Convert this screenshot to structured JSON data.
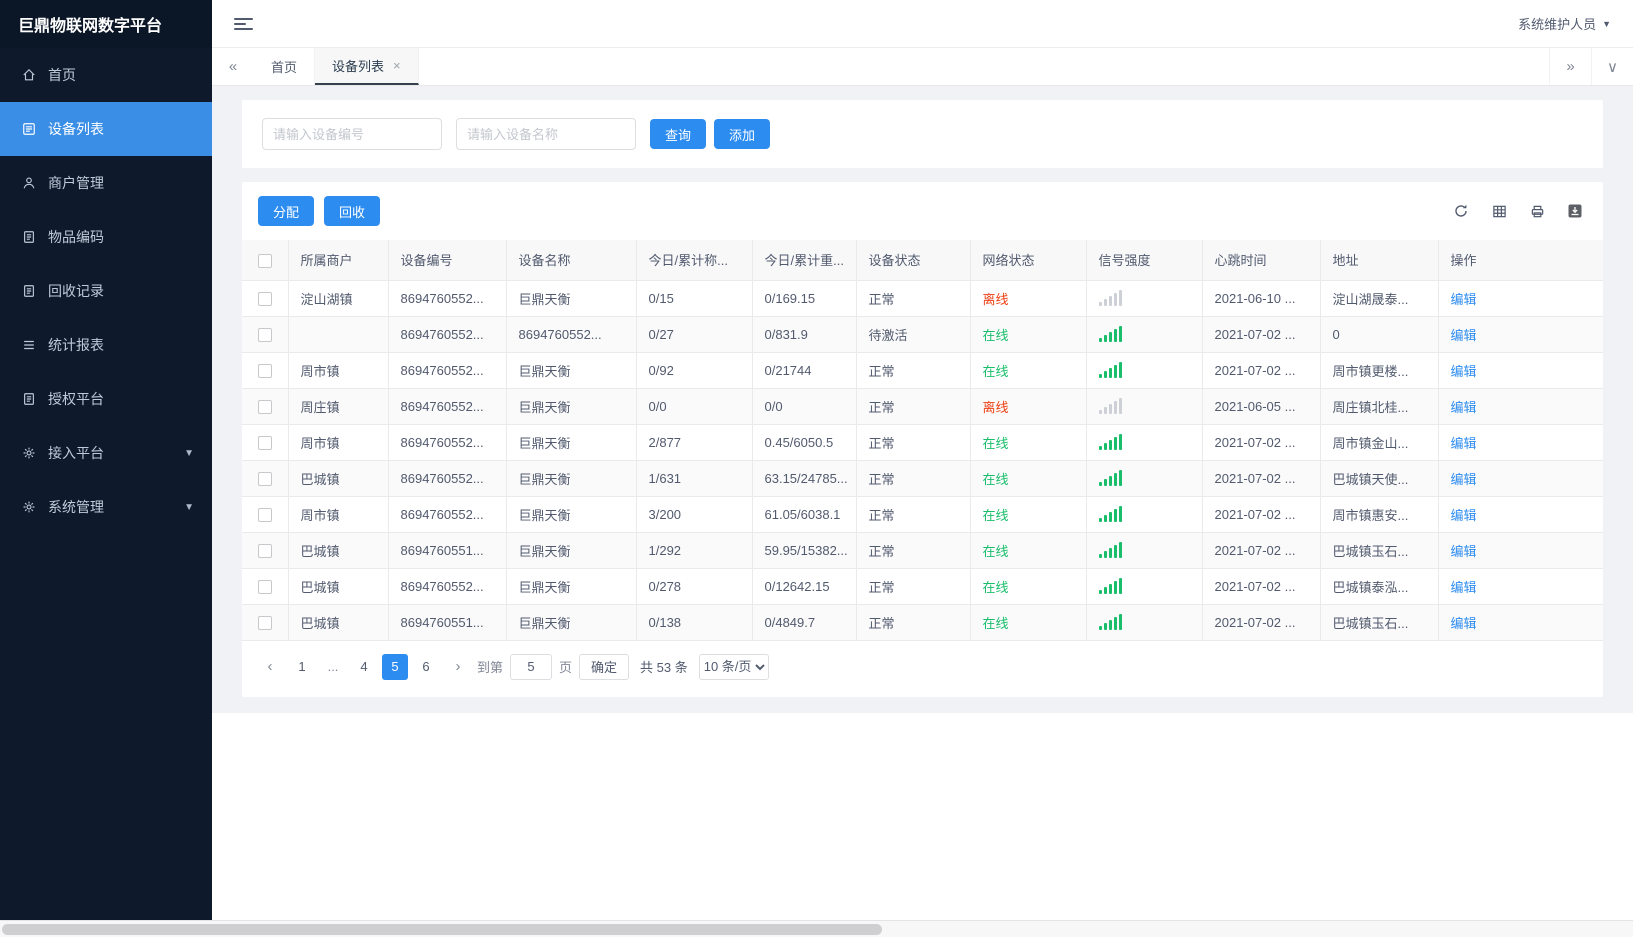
{
  "app": {
    "title": "巨鼎物联网数字平台",
    "user": "系统维护人员"
  },
  "colors": {
    "accent": "#2d8cf0",
    "sidebar_active": "#3a8ee6",
    "online": "#19be6b",
    "offline": "#ed4014"
  },
  "sidebar": {
    "items": [
      {
        "label": "首页",
        "icon": "home",
        "active": false,
        "expandable": false
      },
      {
        "label": "设备列表",
        "icon": "list",
        "active": true,
        "expandable": false
      },
      {
        "label": "商户管理",
        "icon": "user",
        "active": false,
        "expandable": false
      },
      {
        "label": "物品编码",
        "icon": "doc",
        "active": false,
        "expandable": false
      },
      {
        "label": "回收记录",
        "icon": "doc",
        "active": false,
        "expandable": false
      },
      {
        "label": "统计报表",
        "icon": "lines",
        "active": false,
        "expandable": false
      },
      {
        "label": "授权平台",
        "icon": "doc",
        "active": false,
        "expandable": false
      },
      {
        "label": "接入平台",
        "icon": "gear",
        "active": false,
        "expandable": true
      },
      {
        "label": "系统管理",
        "icon": "gear",
        "active": false,
        "expandable": true
      }
    ]
  },
  "tabs": [
    {
      "label": "首页",
      "active": false,
      "closable": false
    },
    {
      "label": "设备列表",
      "active": true,
      "closable": true
    }
  ],
  "search": {
    "device_no_placeholder": "请输入设备编号",
    "device_name_placeholder": "请输入设备名称",
    "query_label": "查询",
    "add_label": "添加"
  },
  "toolbar": {
    "allocate_label": "分配",
    "recycle_label": "回收",
    "icons": [
      "refresh",
      "columns",
      "print",
      "export"
    ]
  },
  "table": {
    "columns": [
      "所属商户",
      "设备编号",
      "设备名称",
      "今日/累计称...",
      "今日/累计重...",
      "设备状态",
      "网络状态",
      "信号强度",
      "心跳时间",
      "地址",
      "操作"
    ],
    "edit_label": "编辑",
    "rows": [
      {
        "merchant": "淀山湖镇",
        "device_no": "8694760552...",
        "device_name": "巨鼎天衡",
        "today_count": "0/15",
        "today_weight": "0/169.15",
        "status": "正常",
        "network": "离线",
        "online": false,
        "heartbeat": "2021-06-10 ...",
        "address": "淀山湖晟泰..."
      },
      {
        "merchant": "",
        "device_no": "8694760552...",
        "device_name": "8694760552...",
        "today_count": "0/27",
        "today_weight": "0/831.9",
        "status": "待激活",
        "network": "在线",
        "online": true,
        "heartbeat": "2021-07-02 ...",
        "address": "0"
      },
      {
        "merchant": "周市镇",
        "device_no": "8694760552...",
        "device_name": "巨鼎天衡",
        "today_count": "0/92",
        "today_weight": "0/21744",
        "status": "正常",
        "network": "在线",
        "online": true,
        "heartbeat": "2021-07-02 ...",
        "address": "周市镇更楼..."
      },
      {
        "merchant": "周庄镇",
        "device_no": "8694760552...",
        "device_name": "巨鼎天衡",
        "today_count": "0/0",
        "today_weight": "0/0",
        "status": "正常",
        "network": "离线",
        "online": false,
        "heartbeat": "2021-06-05 ...",
        "address": "周庄镇北桂..."
      },
      {
        "merchant": "周市镇",
        "device_no": "8694760552...",
        "device_name": "巨鼎天衡",
        "today_count": "2/877",
        "today_weight": "0.45/6050.5",
        "status": "正常",
        "network": "在线",
        "online": true,
        "heartbeat": "2021-07-02 ...",
        "address": "周市镇金山..."
      },
      {
        "merchant": "巴城镇",
        "device_no": "8694760552...",
        "device_name": "巨鼎天衡",
        "today_count": "1/631",
        "today_weight": "63.15/24785...",
        "status": "正常",
        "network": "在线",
        "online": true,
        "heartbeat": "2021-07-02 ...",
        "address": "巴城镇天使..."
      },
      {
        "merchant": "周市镇",
        "device_no": "8694760552...",
        "device_name": "巨鼎天衡",
        "today_count": "3/200",
        "today_weight": "61.05/6038.1",
        "status": "正常",
        "network": "在线",
        "online": true,
        "heartbeat": "2021-07-02 ...",
        "address": "周市镇惠安..."
      },
      {
        "merchant": "巴城镇",
        "device_no": "8694760551...",
        "device_name": "巨鼎天衡",
        "today_count": "1/292",
        "today_weight": "59.95/15382...",
        "status": "正常",
        "network": "在线",
        "online": true,
        "heartbeat": "2021-07-02 ...",
        "address": "巴城镇玉石..."
      },
      {
        "merchant": "巴城镇",
        "device_no": "8694760552...",
        "device_name": "巨鼎天衡",
        "today_count": "0/278",
        "today_weight": "0/12642.15",
        "status": "正常",
        "network": "在线",
        "online": true,
        "heartbeat": "2021-07-02 ...",
        "address": "巴城镇泰泓..."
      },
      {
        "merchant": "巴城镇",
        "device_no": "8694760551...",
        "device_name": "巨鼎天衡",
        "today_count": "0/138",
        "today_weight": "0/4849.7",
        "status": "正常",
        "network": "在线",
        "online": true,
        "heartbeat": "2021-07-02 ...",
        "address": "巴城镇玉石..."
      }
    ]
  },
  "pagination": {
    "pages": [
      "1",
      "...",
      "4",
      "5",
      "6"
    ],
    "active_page": "5",
    "goto_label": "到第",
    "goto_value": "5",
    "page_label": "页",
    "confirm_label": "确定",
    "total_label": "共 53 条",
    "page_size": "10 条/页"
  }
}
